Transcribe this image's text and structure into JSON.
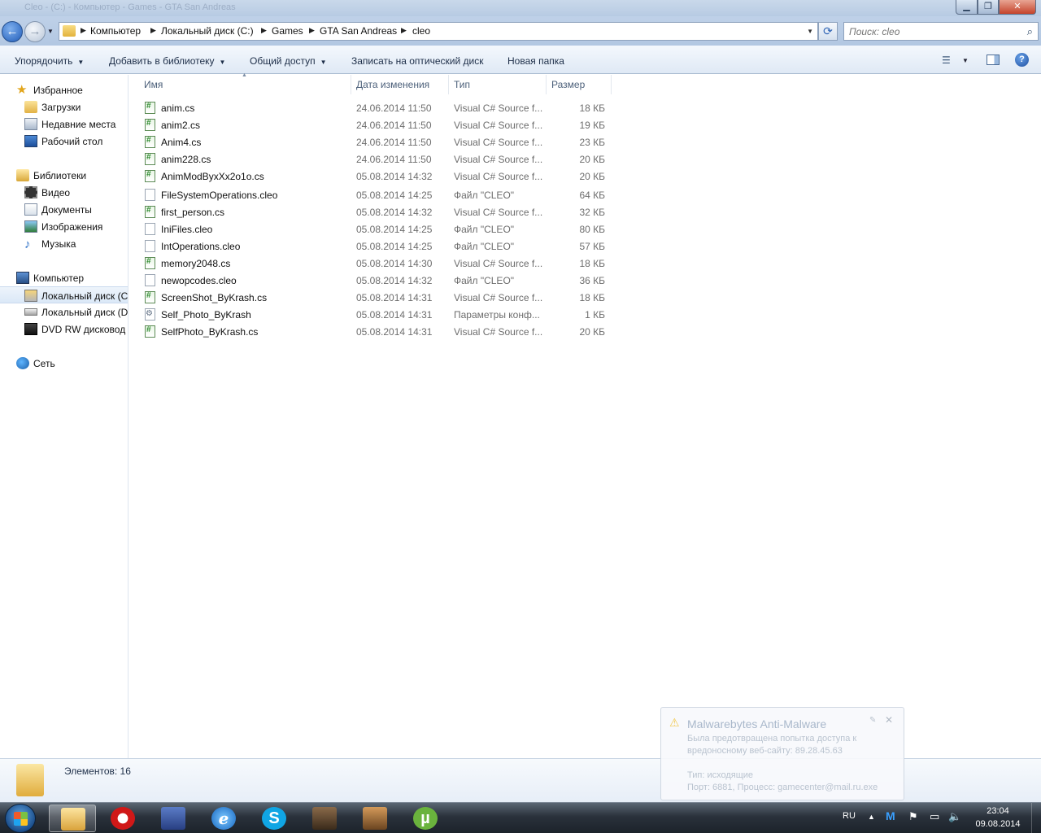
{
  "window": {
    "title_faint": "Cleo - (C:) - Компьютер - Games - GTA San Andreas",
    "min_glyph": "▁",
    "max_glyph": "❐",
    "close_glyph": "✕"
  },
  "address_bar": {
    "back_icon": "←",
    "forward_icon": "→",
    "history_icon": "▼",
    "crumbs": [
      "Компьютер",
      "Локальный диск (C:)",
      "Games",
      "GTA San Andreas",
      "cleo"
    ],
    "separator": "▶",
    "dropdown_icon": "▼",
    "refresh_icon": "⟳"
  },
  "search": {
    "placeholder": "Поиск: cleo",
    "icon": "⌕"
  },
  "toolbar": {
    "organize": "Упорядочить",
    "add_to_library": "Добавить в библиотеку",
    "share": "Общий доступ",
    "burn": "Записать на оптический диск",
    "new_folder": "Новая папка",
    "dropdown_glyph": "▼",
    "views_icon": "☰",
    "help": "?"
  },
  "sidebar": {
    "favorites": "Избранное",
    "downloads": "Загрузки",
    "recent": "Недавние места",
    "desktop": "Рабочий стол",
    "libraries": "Библиотеки",
    "video": "Видео",
    "documents": "Документы",
    "images": "Изображения",
    "music": "Музыка",
    "computer": "Компьютер",
    "drive_c": "Локальный диск (C",
    "drive_d": "Локальный диск (D",
    "dvd": "DVD RW дисковод (",
    "network": "Сеть",
    "star_glyph": "★",
    "music_glyph": "♪"
  },
  "columns": {
    "name": "Имя",
    "date": "Дата изменения",
    "type": "Тип",
    "size": "Размер",
    "sort_glyph": "▲"
  },
  "files": [
    {
      "name": "anim.cs",
      "date": "24.06.2014 11:50",
      "type": "Visual C# Source f...",
      "size": "18 КБ",
      "kind": "cs"
    },
    {
      "name": "anim2.cs",
      "date": "24.06.2014 11:50",
      "type": "Visual C# Source f...",
      "size": "19 КБ",
      "kind": "cs"
    },
    {
      "name": "Anim4.cs",
      "date": "24.06.2014 11:50",
      "type": "Visual C# Source f...",
      "size": "23 КБ",
      "kind": "cs"
    },
    {
      "name": "anim228.cs",
      "date": "24.06.2014 11:50",
      "type": "Visual C# Source f...",
      "size": "20 КБ",
      "kind": "cs"
    },
    {
      "name": "AnimModByxXx2o1o.cs",
      "date": "05.08.2014 14:32",
      "type": "Visual C# Source f...",
      "size": "20 КБ",
      "kind": "cs"
    },
    {
      "name": "FileSystemOperations.cleo",
      "date": "05.08.2014 14:25",
      "type": "Файл \"CLEO\"",
      "size": "64 КБ",
      "kind": "cleo"
    },
    {
      "name": "first_person.cs",
      "date": "05.08.2014 14:32",
      "type": "Visual C# Source f...",
      "size": "32 КБ",
      "kind": "cs"
    },
    {
      "name": "IniFiles.cleo",
      "date": "05.08.2014 14:25",
      "type": "Файл \"CLEO\"",
      "size": "80 КБ",
      "kind": "cleo"
    },
    {
      "name": "IntOperations.cleo",
      "date": "05.08.2014 14:25",
      "type": "Файл \"CLEO\"",
      "size": "57 КБ",
      "kind": "cleo"
    },
    {
      "name": "memory2048.cs",
      "date": "05.08.2014 14:30",
      "type": "Visual C# Source f...",
      "size": "18 КБ",
      "kind": "cs"
    },
    {
      "name": "newopcodes.cleo",
      "date": "05.08.2014 14:32",
      "type": "Файл \"CLEO\"",
      "size": "36 КБ",
      "kind": "cleo"
    },
    {
      "name": "ScreenShot_ByKrash.cs",
      "date": "05.08.2014 14:31",
      "type": "Visual C# Source f...",
      "size": "18 КБ",
      "kind": "cs"
    },
    {
      "name": "Self_Photo_ByKrash",
      "date": "05.08.2014 14:31",
      "type": "Параметры конф...",
      "size": "1 КБ",
      "kind": "cfg"
    },
    {
      "name": "SelfPhoto_ByKrash.cs",
      "date": "05.08.2014 14:31",
      "type": "Visual C# Source f...",
      "size": "20 КБ",
      "kind": "cs"
    }
  ],
  "details": {
    "count": "Элементов: 16"
  },
  "notification": {
    "warn_icon": "⚠",
    "title": "Malwarebytes Anti-Malware",
    "pin_icon": "✎",
    "close_icon": "✕",
    "line1": "Была предотвращена попытка доступа к",
    "line2": "вредоносному веб-сайту:  89.28.45.63",
    "line3": "Тип:  исходящие",
    "line4": "Порт:  6881, Процесс:  gamecenter@mail.ru.exe"
  },
  "taskbar": {
    "ie_glyph": "e",
    "skype_glyph": "S",
    "torrent_glyph": "µ",
    "lang": "RU",
    "tray_up": "▲",
    "mbam_glyph": "M",
    "flag_glyph": "⚑",
    "net_glyph": "▭",
    "vol_glyph": "🔈",
    "time": "23:04",
    "date": "09.08.2014"
  }
}
